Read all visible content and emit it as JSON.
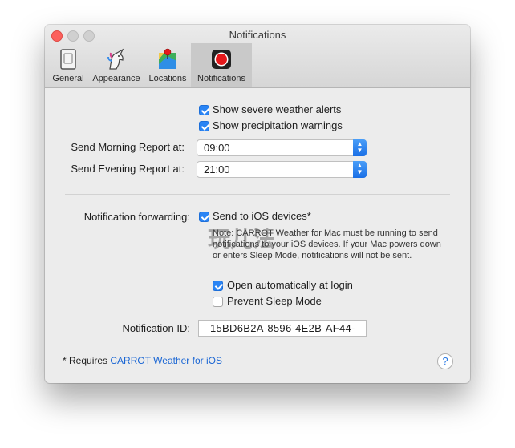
{
  "window": {
    "title": "Notifications"
  },
  "toolbar": {
    "items": [
      {
        "label": "General",
        "icon": "general-icon"
      },
      {
        "label": "Appearance",
        "icon": "unicorn-icon"
      },
      {
        "label": "Locations",
        "icon": "map-pin-icon"
      },
      {
        "label": "Notifications",
        "icon": "record-icon",
        "selected": true
      }
    ]
  },
  "alerts": {
    "severe_label": "Show severe weather alerts",
    "severe_checked": true,
    "precip_label": "Show precipitation warnings",
    "precip_checked": true
  },
  "reports": {
    "morning_label": "Send Morning Report at:",
    "morning_value": "09:00",
    "evening_label": "Send Evening Report at:",
    "evening_value": "21:00"
  },
  "forwarding": {
    "label": "Notification forwarding:",
    "send_ios_label": "Send to iOS devices*",
    "send_ios_checked": true,
    "note": "Note: CARROT Weather for Mac must be running to send notifications to your iOS devices. If your Mac powers down or enters Sleep Mode, notifications will not be sent.",
    "open_login_label": "Open automatically at login",
    "open_login_checked": true,
    "prevent_sleep_label": "Prevent Sleep Mode",
    "prevent_sleep_checked": false
  },
  "notification_id": {
    "label": "Notification ID:",
    "value": "15BD6B2A-8596-4E2B-AF44-"
  },
  "footer": {
    "prefix": "* Requires ",
    "link": "CARROT Weather for iOS",
    "help": "?"
  },
  "watermark": "玩儿法",
  "colors": {
    "accent": "#2a84f4",
    "close": "#fc605c",
    "record_red": "#e5191c"
  }
}
